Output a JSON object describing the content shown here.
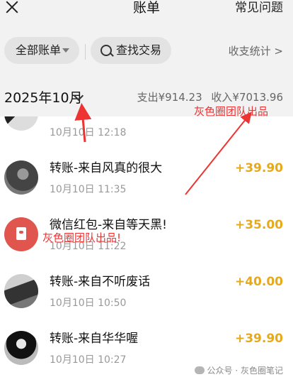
{
  "header": {
    "title": "账单",
    "faq_label": "常见问题"
  },
  "filters": {
    "all_accounts": "全部账单",
    "search_label": "查找交易",
    "stats_label": "收支统计 >"
  },
  "month_bar": {
    "month": "2025年10月",
    "expense": "支出¥914.23",
    "income": "收入¥7013.96"
  },
  "transactions": [
    {
      "name": "",
      "time": "10月10日 12:18",
      "amount": ""
    },
    {
      "name": "转账-来自风真的很大",
      "time": "10月10日 11:35",
      "amount": "+39.90"
    },
    {
      "name": "微信红包-来自等天黑!",
      "time": "10月10日 11:22",
      "amount": "+35.00"
    },
    {
      "name": "转账-来自不听废话",
      "time": "10月10日 10:50",
      "amount": "+40.00"
    },
    {
      "name": "转账-来自华华喔",
      "time": "10月10日 10:27",
      "amount": "+39.90"
    }
  ],
  "watermarks": {
    "top": "灰色圈团队出品",
    "middle": "灰色圈团队出品!"
  },
  "footer": {
    "text": "公众号 · 灰色圈笔记"
  },
  "colors": {
    "amount": "#e6a91a",
    "watermark": "#ee3333",
    "background": "#f2f2f2"
  }
}
